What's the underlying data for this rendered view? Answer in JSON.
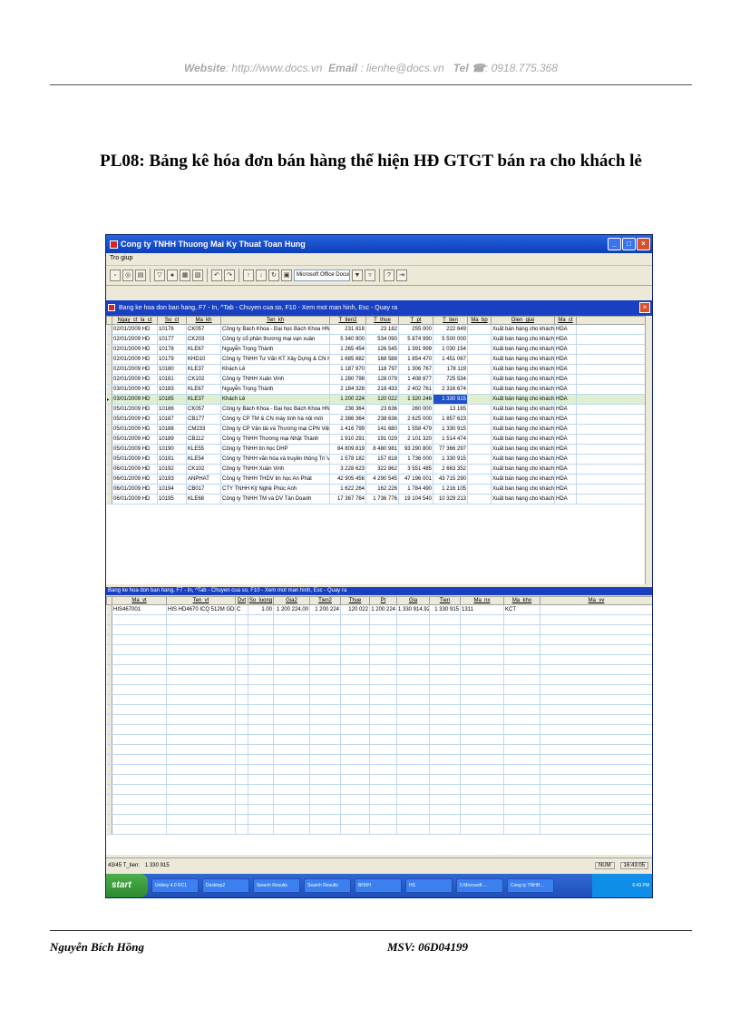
{
  "header": {
    "website_label": "Website",
    "website_value": ": http://www.docs.vn",
    "email_label": "Email",
    "email_value": ": lienhe@docs.vn",
    "tel_label": "Tel ☎",
    "tel_value": ": 0918.775.368"
  },
  "doc_title": "PL08: Bảng kê hóa đơn bán hàng thể hiện HĐ GTGT bán ra cho khách lẻ",
  "app": {
    "title": "Cong ty TNHH Thuong Mai Ky Thuat Toan Hung",
    "menu": "Tro giup",
    "toolbar_combo": "Microsoft Office Docum",
    "upper_pane_title": "Bang ke hoa don ban hang, F7 - In, ^Tab - Chuyen cua so, F10 - Xem mot man hinh, Esc - Quay ra",
    "lower_pane_title": "Bang ke hoa don ban hang, F7 - In, ^Tab - Chuyen cua so, F10 - Xem mot man hinh, Esc - Quay ra",
    "upper_columns": [
      "Ngay_ct_la_ct",
      "So_ct",
      "Ma_kh",
      "Ten_kh",
      "T_tien2",
      "T_thue",
      "T_pt",
      "T_tien",
      "Ma_bp",
      "Dien_giai",
      "Ma_ct"
    ],
    "upper_rows": [
      [
        "02/01/2009 HD",
        "10176",
        "CK057",
        "Công ty Bách Khoa - Đại học Bách Khoa HN",
        "231 818",
        "23 182",
        "255 000",
        "222 649",
        "",
        "Xuất bán hàng cho khách",
        "HDA"
      ],
      [
        "02/01/2009 HD",
        "10177",
        "CK203",
        "Công ty cổ phần thương mại vạn xuân",
        "5 340 900",
        "534 090",
        "5 874 990",
        "5 500 000",
        "",
        "Xuất bán hàng cho khách",
        "HDA"
      ],
      [
        "02/01/2009 HD",
        "10178",
        "KLE67",
        "Nguyễn Trọng Thành",
        "1 265 454",
        "126 545",
        "1 391 999",
        "1 030 154",
        "",
        "Xuất bán hàng cho khách",
        "HDA"
      ],
      [
        "02/01/2009 HD",
        "10179",
        "KHD10",
        "Công ty TNHH Tư Vấn KT Xây Dựng & CN Hà Nội",
        "1 685 882",
        "168 588",
        "1 854 470",
        "1 451 067",
        "",
        "Xuất bán hàng cho khách",
        "HDA"
      ],
      [
        "02/01/2009 HD",
        "10180",
        "KLE37",
        "Khách Lẻ",
        "1 187 970",
        "118 797",
        "1 306 767",
        "178 119",
        "",
        "Xuất bán hàng cho khách",
        "HDA"
      ],
      [
        "02/01/2009 HD",
        "10181",
        "CK102",
        "Công ty TNHH Xuân Vinh",
        "1 280 798",
        "128 079",
        "1 408 877",
        "725 534",
        "",
        "Xuất bán hàng cho khách",
        "HDA"
      ],
      [
        "03/01/2009 HD",
        "10183",
        "KLE67",
        "Nguyễn Trọng Thành",
        "2 184 328",
        "218 433",
        "2 402 761",
        "2 316 674",
        "",
        "Xuất bán hàng cho khách",
        "HDA"
      ],
      [
        "03/01/2009 HD",
        "10185",
        "KLE37",
        "Khách Lẻ",
        "1 200 224",
        "120 022",
        "1 320 246",
        "1 330 915",
        "",
        "Xuất bán hàng cho khách",
        "HDA"
      ],
      [
        "05/01/2009 HD",
        "10186",
        "CK057",
        "Công ty Bách Khoa - Đại học Bách Khoa HN",
        "236 364",
        "23 636",
        "260 000",
        "13 165",
        "",
        "Xuất bán hàng cho khách",
        "HDA"
      ],
      [
        "05/01/2009 HD",
        "10187",
        "CB177",
        "Công ty CP TM & CN máy tính hà nội mới",
        "2 386 364",
        "238 636",
        "2 625 000",
        "1 857 623",
        "",
        "Xuất bán hàng cho khách",
        "HDA"
      ],
      [
        "05/01/2009 HD",
        "10188",
        "CM233",
        "Công ty CP Vận tải và Thương mại CPN Việt Nam",
        "1 416 799",
        "141 680",
        "1 558 479",
        "1 330 915",
        "",
        "Xuất bán hàng cho khách",
        "HDA"
      ],
      [
        "05/01/2009 HD",
        "10189",
        "CB112",
        "Công ty TNHH Thương mại Nhật Thành",
        "1 910 291",
        "191 029",
        "2 101 320",
        "1 514 474",
        "",
        "Xuất bán hàng cho khách",
        "HDA"
      ],
      [
        "05/01/2009 HD",
        "10190",
        "KLE55",
        "Công ty TNHH tin học DHP",
        "84 809 819",
        "8 480 981",
        "93 290 800",
        "77 366 297",
        "",
        "Xuất bán hàng cho khách",
        "HDA"
      ],
      [
        "05/01/2009 HD",
        "10191",
        "KLE54",
        "Công ty TNHH văn hóa và truyền thông Trí Việt",
        "1 578 182",
        "157 818",
        "1 736 000",
        "1 330 915",
        "",
        "Xuất bán hàng cho khách",
        "HDA"
      ],
      [
        "06/01/2009 HD",
        "10192",
        "CK102",
        "Công ty TNHH Xuân Vinh",
        "3 228 623",
        "322 862",
        "3 551 485",
        "2 663 352",
        "",
        "Xuất bán hàng cho khách",
        "HDA"
      ],
      [
        "06/01/2009 HD",
        "10193",
        "ANPHAT",
        "Công ty TNHH THDV tin học An Phát",
        "42 905 456",
        "4 290 545",
        "47 196 001",
        "43 715 290",
        "",
        "Xuất bán hàng cho khách",
        "HDA"
      ],
      [
        "06/01/2009 HD",
        "10194",
        "CB017",
        "CTY TNHH Kỹ Nghệ Phúc Anh",
        "1 622 264",
        "162 226",
        "1 784 490",
        "1 216 105",
        "",
        "Xuất bán hàng cho khách",
        "HDA"
      ],
      [
        "06/01/2009 HD",
        "10195",
        "KLE68",
        "Công ty TNHH TM và DV Tân Doanh",
        "17 367 764",
        "1 736 776",
        "19 104 540",
        "10 329 213",
        "",
        "Xuất bán hàng cho khách",
        "HDA"
      ]
    ],
    "lower_columns": [
      "Ma_vt",
      "Ten_vt",
      "Dvt",
      "So_luong",
      "Gia2",
      "Tien2",
      "Thue",
      "Pt",
      "Gia",
      "Tien",
      "Ma_nx",
      "Ma_kho",
      "Ma_vv"
    ],
    "lower_rows": [
      [
        "HIS467001",
        "HIS HD4670 ICQ 512M GDDR3",
        "C",
        "1.00",
        "1 200 224.00",
        "1 200 224",
        "120 022",
        "1 200 224",
        "1 330 914.92",
        "1 330 915",
        "1311",
        "KCT",
        ""
      ]
    ],
    "status_left": "43/45 T_tien:",
    "status_value": "1 330 915",
    "status_num": "NUM",
    "status_time": "16:43:05",
    "taskbar": {
      "start": "start",
      "items": [
        "Unikey 4.0 RC1",
        "Desktop2",
        "Search Results",
        "Search Results",
        "BHXH",
        "HS",
        "5 Microsoft ...",
        "Cong ty TNHH..."
      ],
      "clock": "6:43 PM"
    }
  },
  "footer": {
    "author": "Nguyễn Bích Hồng",
    "student_id": "MSV: 06D04199"
  }
}
